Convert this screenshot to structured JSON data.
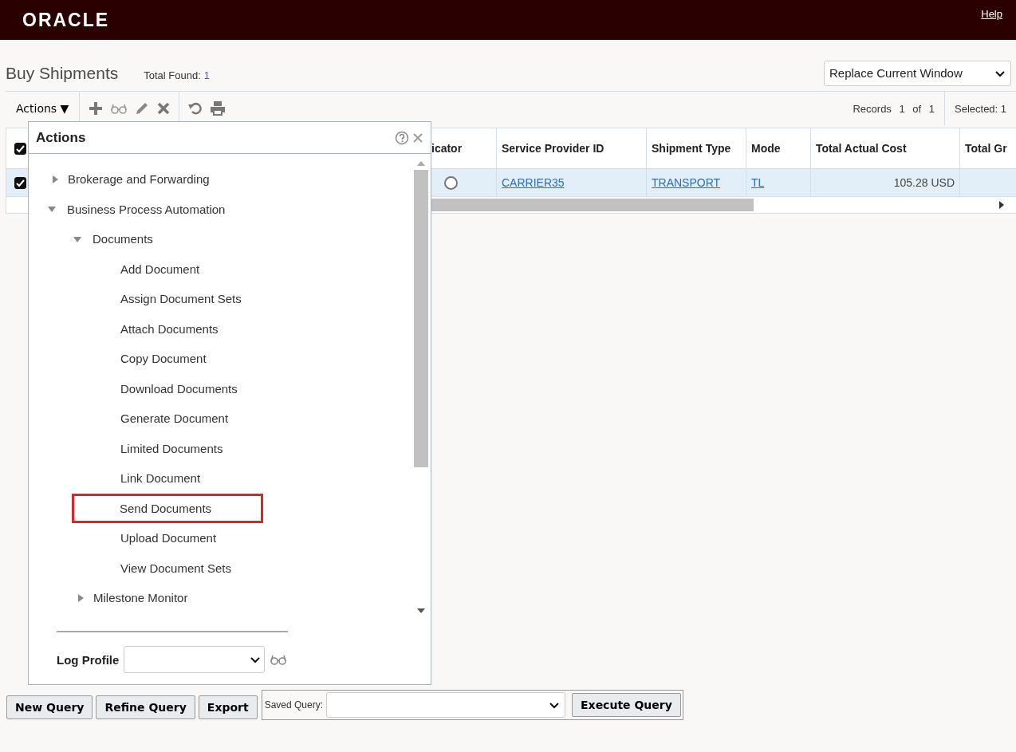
{
  "header": {
    "logo": "ORACLE",
    "help": "Help"
  },
  "page": {
    "title": "Buy Shipments",
    "total_label": "Total Found:",
    "total_value": "1",
    "window_select": "Replace Current Window"
  },
  "toolbar": {
    "actions": "Actions ▼",
    "records_label": "Records",
    "records_current": "1",
    "records_of": "of",
    "records_total": "1",
    "selected_label": "Selected:",
    "selected_value": "1"
  },
  "table": {
    "columns": [
      "icator",
      "Service Provider ID",
      "Shipment Type",
      "Mode",
      "Total Actual Cost",
      "Total Gr"
    ],
    "rows": [
      {
        "checked": true,
        "cells": [
          {
            "kind": "radio",
            "selected": false
          },
          {
            "kind": "link",
            "text": "CARRIER35"
          },
          {
            "kind": "link",
            "text": "TRANSPORT"
          },
          {
            "kind": "link",
            "text": "TL"
          },
          {
            "kind": "amount",
            "text": "105.28 USD"
          }
        ]
      }
    ],
    "header_checked": true
  },
  "actions_popup": {
    "title": "Actions",
    "tree": [
      {
        "label": "Brokerage and Forwarding",
        "expanded": false
      },
      {
        "label": "Business Process Automation",
        "expanded": true,
        "children": [
          {
            "label": "Documents",
            "expanded": true,
            "children": [
              {
                "label": "Add Document",
                "highlighted": false
              },
              {
                "label": "Assign Document Sets",
                "highlighted": false
              },
              {
                "label": "Attach Documents",
                "highlighted": false
              },
              {
                "label": "Copy Document",
                "highlighted": false
              },
              {
                "label": "Download Documents",
                "highlighted": false
              },
              {
                "label": "Generate Document",
                "highlighted": false
              },
              {
                "label": "Limited Documents",
                "highlighted": false
              },
              {
                "label": "Link Document",
                "highlighted": false
              },
              {
                "label": "Send Documents",
                "highlighted": true
              },
              {
                "label": "Upload Document",
                "highlighted": false
              },
              {
                "label": "View Document Sets",
                "highlighted": false
              }
            ]
          },
          {
            "label": "Milestone Monitor",
            "expanded": false
          }
        ]
      }
    ],
    "log_profile_label": "Log Profile"
  },
  "bottom_bar": {
    "buttons": [
      "New Query",
      "Refine Query",
      "Export"
    ],
    "saved_query_label": "Saved Query:",
    "execute": "Execute Query"
  }
}
